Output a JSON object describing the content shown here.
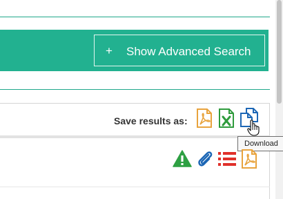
{
  "advanced_search": {
    "plus": "+",
    "label": "Show Advanced Search"
  },
  "save_results": {
    "label": "Save results as:",
    "formats": [
      {
        "icon": "pdf-file-icon",
        "color": "#e8a33d"
      },
      {
        "icon": "excel-file-icon",
        "color": "#2e9b3c"
      },
      {
        "icon": "copy-files-icon",
        "color": "#1c66b5"
      }
    ]
  },
  "tooltip": {
    "text": "Download"
  },
  "result_actions": [
    {
      "icon": "warning-icon",
      "color": "#2ea043"
    },
    {
      "icon": "paperclip-icon",
      "color": "#1c66b5"
    },
    {
      "icon": "list-icon",
      "color": "#e0302a"
    },
    {
      "icon": "pdf-file-icon",
      "color": "#e8a33d"
    }
  ],
  "colors": {
    "accent": "#22b190",
    "rule": "#1fa88a"
  }
}
